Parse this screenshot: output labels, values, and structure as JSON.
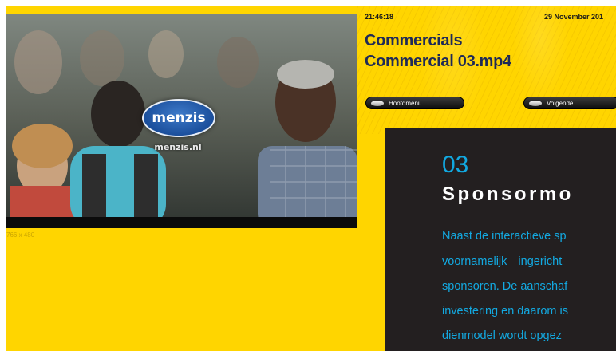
{
  "player": {
    "logo_text": "menzis",
    "logo_url_text": "menzis.nl",
    "dimensions_label": "766 x 480"
  },
  "info": {
    "time": "21:46:18",
    "date": "29 November 201",
    "category": "Commercials",
    "filename": "Commercial 03.mp4"
  },
  "buttons": {
    "menu_label": "Hoofdmenu",
    "next_label": "Volgende"
  },
  "article": {
    "number": "03",
    "heading": "Sponsormo",
    "lines": [
      "Naast de interactieve sp",
      "voornamelijk ingericht",
      "sponsoren. De aanschaf",
      "investering en daarom is",
      "dienmodel wordt opgez"
    ]
  },
  "colors": {
    "yellow": "#ffd500",
    "navy": "#1f2a57",
    "dark_panel": "#231f20",
    "accent_blue": "#13a9e1"
  }
}
